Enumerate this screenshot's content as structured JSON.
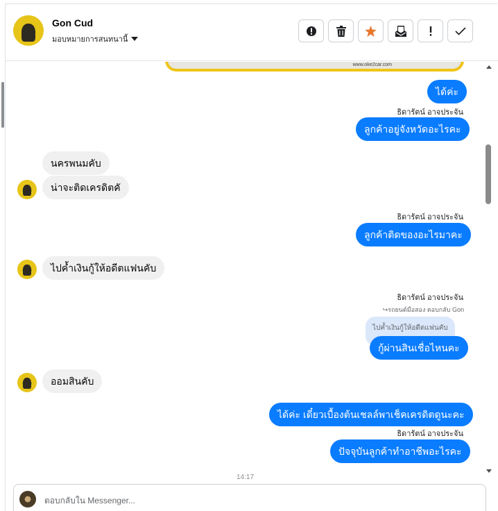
{
  "header": {
    "contact_name": "Gon Cud",
    "assign_label": "มอบหมายการสนทนานี้",
    "actions": [
      {
        "icon": "alert-circle-icon"
      },
      {
        "icon": "trash-icon"
      },
      {
        "icon": "star-icon"
      },
      {
        "icon": "mark-unread-icon"
      },
      {
        "icon": "exclamation-icon"
      },
      {
        "icon": "check-icon"
      }
    ]
  },
  "messages": {
    "m1": "ได้ค่ะ",
    "m1_sender": "ธิดารัตน์ อาจประจัน",
    "m2": "ลูกค้าอยู่จังหวัดอะไรคะ",
    "m3": "นครพนมคับ",
    "m4": "น่าจะติดเครดิตคั",
    "m5_sender": "ธิดารัตน์ อาจประจัน",
    "m5": "ลูกค้าติดของอะไรมาคะ",
    "m6": "ไปค้ำเงินกู้ให้อดีตแฟนคับ",
    "m7_sender": "ธิดารัตน์ อาจประจัน",
    "m7_reply_meta": "รถยนต์มือสอง ตอบกลับ Gon",
    "m7_quoted": "ไปค้ำเงินกู้ให้อดีตแฟนคับ",
    "m7": "กู้ผ่านสินเชื่อไหนคะ",
    "m8": "ออมสินคับ",
    "m9": "ได้ค่ะ เดี๋ยวเบื้องต้นเชลล์พาเช็คเครดิตดูนะคะ",
    "m10_sender": "ธิดารัตน์ อาจประจัน",
    "m10": "ปัจจุบันลูกค้าทำอาชีพอะไรคะ",
    "timestamp": "14:17"
  },
  "image_preview": {
    "caption": "www.oke2car.com"
  },
  "composer": {
    "placeholder": "ตอบกลับใน Messenger..."
  },
  "colors": {
    "outgoing_bubble": "#0a7cff",
    "incoming_bubble": "#f0f0f0",
    "star_accent": "#e8782b"
  }
}
